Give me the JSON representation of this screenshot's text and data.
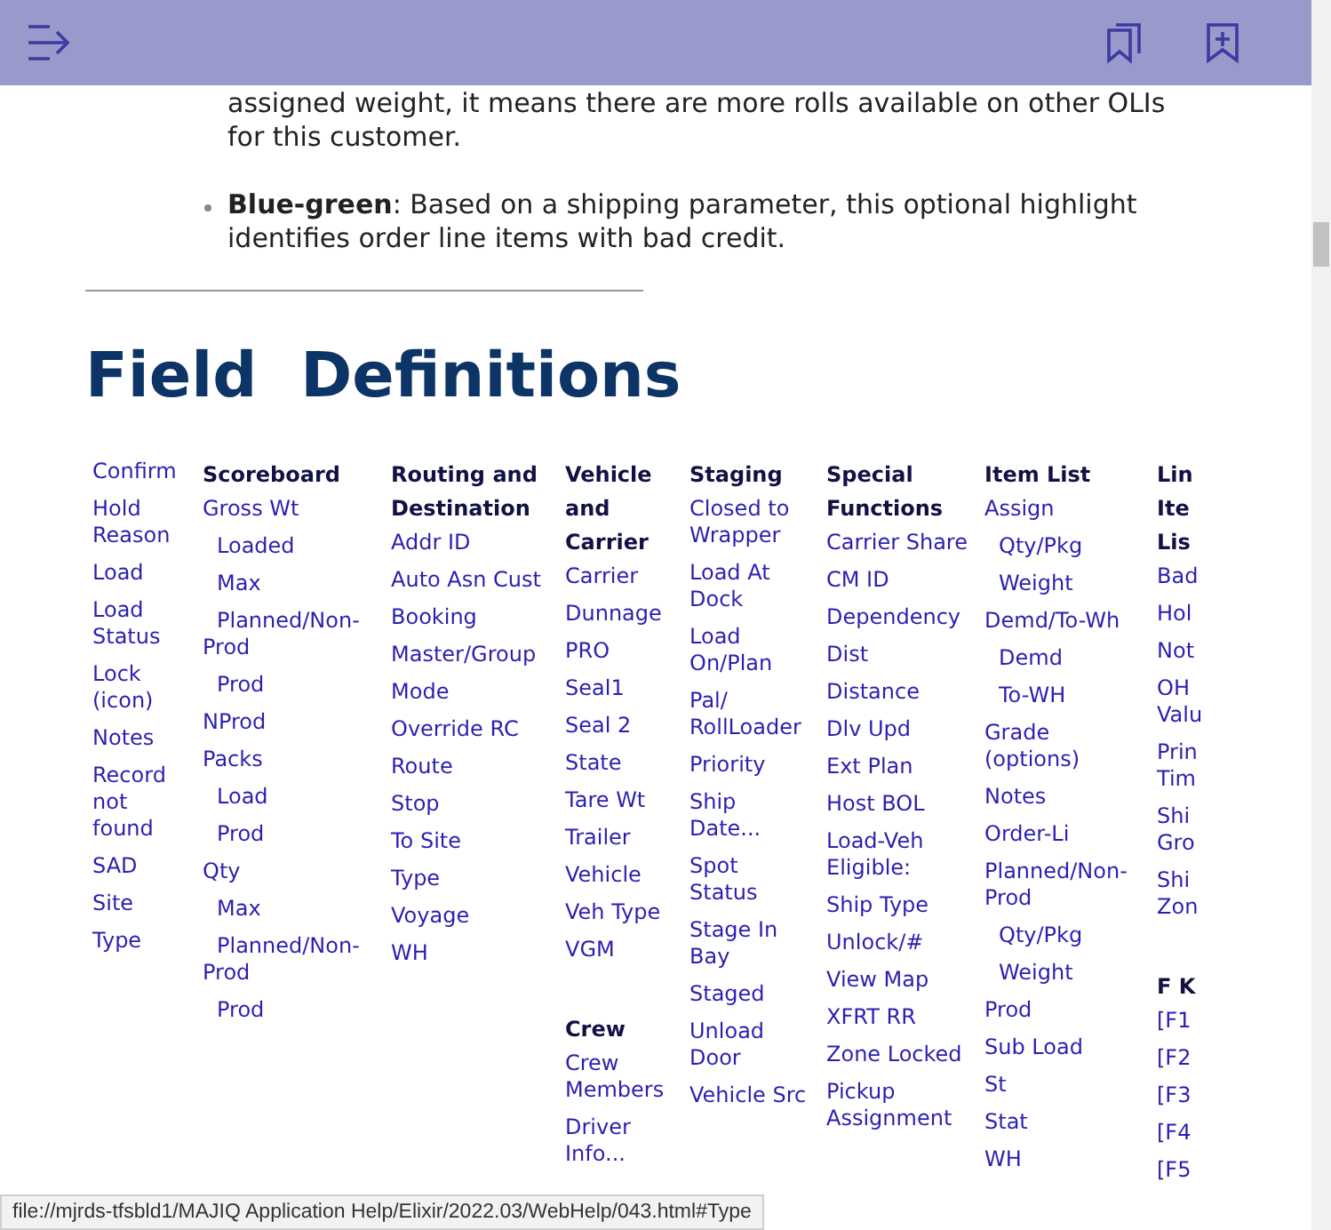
{
  "toolbar": {
    "buttons": [
      {
        "kind": "toc"
      },
      {
        "kind": "bookmarks"
      },
      {
        "kind": "add-bookmark"
      }
    ]
  },
  "bullets": [
    {
      "text": "assigned weight, it means there are more rolls available on other OLIs for this customer.",
      "bullet": false
    },
    {
      "text": "**Blue-green**: Based on a shipping parameter, this optional highlight identifies order line items with bad credit.",
      "bullet": true
    }
  ],
  "title": "Field  Definitions",
  "columns": [
    {
      "sections": [
        {
          "items": [
            {
              "text": "Confirm",
              "indent": false
            },
            {
              "text": "Hold Reason",
              "indent": false
            },
            {
              "text": "Load",
              "indent": false
            },
            {
              "text": "Load Status",
              "indent": false
            },
            {
              "text": "Lock (icon)",
              "indent": false
            },
            {
              "text": "Notes",
              "indent": false
            },
            {
              "text": "Record not found",
              "indent": false
            },
            {
              "text": "SAD",
              "indent": false
            },
            {
              "text": "Site",
              "indent": false
            },
            {
              "text": "Type",
              "indent": false
            }
          ]
        }
      ]
    },
    {
      "sections": [
        {
          "heading": "Scoreboard",
          "items": [
            {
              "text": "Gross Wt",
              "indent": false
            },
            {
              "text": "Loaded",
              "indent": true
            },
            {
              "text": "Max",
              "indent": true
            },
            {
              "text": "Planned/Non-Prod",
              "indent": true
            },
            {
              "text": "Prod",
              "indent": true
            },
            {
              "text": "NProd",
              "indent": false
            },
            {
              "text": "Packs",
              "indent": false
            },
            {
              "text": "Load",
              "indent": true
            },
            {
              "text": "Prod",
              "indent": true
            },
            {
              "text": "Qty",
              "indent": false
            },
            {
              "text": "Max",
              "indent": true
            },
            {
              "text": "Planned/Non-Prod",
              "indent": true
            },
            {
              "text": "Prod",
              "indent": true
            }
          ]
        }
      ]
    },
    {
      "sections": [
        {
          "heading": "Routing and Destination",
          "items": [
            {
              "text": "Addr ID",
              "indent": false
            },
            {
              "text": "Auto Asn Cust",
              "indent": false
            },
            {
              "text": "Booking",
              "indent": false
            },
            {
              "text": "Master/Group",
              "indent": false
            },
            {
              "text": "Mode",
              "indent": false
            },
            {
              "text": "Override RC",
              "indent": false
            },
            {
              "text": "Route",
              "indent": false
            },
            {
              "text": "Stop",
              "indent": false
            },
            {
              "text": "To Site",
              "indent": false
            },
            {
              "text": "Type",
              "indent": false
            },
            {
              "text": "Voyage",
              "indent": false
            },
            {
              "text": "WH",
              "indent": false
            }
          ]
        }
      ]
    },
    {
      "sections": [
        {
          "heading": "Vehicle and Carrier",
          "items": [
            {
              "text": "Carrier",
              "indent": false
            },
            {
              "text": "Dunnage",
              "indent": false
            },
            {
              "text": "PRO",
              "indent": false
            },
            {
              "text": "Seal1",
              "indent": false
            },
            {
              "text": "Seal 2",
              "indent": false
            },
            {
              "text": "State",
              "indent": false
            },
            {
              "text": "Tare Wt",
              "indent": false
            },
            {
              "text": "Trailer",
              "indent": false
            },
            {
              "text": "Vehicle",
              "indent": false
            },
            {
              "text": "Veh Type",
              "indent": false
            },
            {
              "text": "VGM",
              "indent": false
            }
          ]
        },
        {
          "heading": "Crew",
          "items": [
            {
              "text": "Crew Members",
              "indent": false
            },
            {
              "text": "Driver Info...",
              "indent": false
            }
          ]
        }
      ]
    },
    {
      "sections": [
        {
          "heading": "Staging",
          "items": [
            {
              "text": "Closed to Wrapper",
              "indent": false
            },
            {
              "text": "Load At Dock",
              "indent": false
            },
            {
              "text": "Load On/Plan",
              "indent": false
            },
            {
              "text": "Pal/ RollLoader",
              "indent": false
            },
            {
              "text": "Priority",
              "indent": false
            },
            {
              "text": "Ship Date...",
              "indent": false
            },
            {
              "text": "Spot Status",
              "indent": false
            },
            {
              "text": "Stage In Bay",
              "indent": false
            },
            {
              "text": "Staged",
              "indent": false
            },
            {
              "text": "Unload Door",
              "indent": false
            },
            {
              "text": "Vehicle Src",
              "indent": false
            }
          ]
        }
      ]
    },
    {
      "sections": [
        {
          "heading": "Special Functions",
          "items": [
            {
              "text": "Carrier Share",
              "indent": false
            },
            {
              "text": "CM ID",
              "indent": false
            },
            {
              "text": "Dependency",
              "indent": false
            },
            {
              "text": "Dist",
              "indent": false
            },
            {
              "text": "Distance",
              "indent": false
            },
            {
              "text": "Dlv Upd",
              "indent": false
            },
            {
              "text": "Ext Plan",
              "indent": false
            },
            {
              "text": "Host BOL",
              "indent": false
            },
            {
              "text": "Load-Veh Eligible:",
              "indent": false
            },
            {
              "text": "Ship Type",
              "indent": false
            },
            {
              "text": "Unlock/#",
              "indent": false
            },
            {
              "text": "View Map",
              "indent": false
            },
            {
              "text": "XFRT RR",
              "indent": false
            },
            {
              "text": "Zone Locked",
              "indent": false
            },
            {
              "text": "Pickup Assignment",
              "indent": false
            }
          ]
        }
      ]
    },
    {
      "sections": [
        {
          "heading": "Item List",
          "items": [
            {
              "text": "Assign",
              "indent": false
            },
            {
              "text": "Qty/Pkg",
              "indent": true
            },
            {
              "text": "Weight",
              "indent": true
            },
            {
              "text": "Demd/To-Wh",
              "indent": false
            },
            {
              "text": "Demd",
              "indent": true
            },
            {
              "text": "To-WH",
              "indent": true
            },
            {
              "text": "Grade (options)",
              "indent": false
            },
            {
              "text": "Notes",
              "indent": false
            },
            {
              "text": "Order-Li",
              "indent": false
            },
            {
              "text": "Planned/Non-Prod",
              "indent": false
            },
            {
              "text": "Qty/Pkg",
              "indent": true
            },
            {
              "text": "Weight",
              "indent": true
            },
            {
              "text": "Prod",
              "indent": false
            },
            {
              "text": "Sub Load",
              "indent": false
            },
            {
              "text": "St",
              "indent": false
            },
            {
              "text": "Stat",
              "indent": false
            },
            {
              "text": "WH",
              "indent": false
            }
          ]
        }
      ]
    },
    {
      "sections": [
        {
          "heading": "Lin Ite Lis",
          "items": [
            {
              "text": "Bad",
              "indent": false
            },
            {
              "text": "Hol",
              "indent": false
            },
            {
              "text": "Not",
              "indent": false
            },
            {
              "text": "OH Valu",
              "indent": false
            },
            {
              "text": "Prin Tim",
              "indent": false
            },
            {
              "text": "Shi Gro",
              "indent": false
            },
            {
              "text": "Shi Zon",
              "indent": false
            }
          ]
        },
        {
          "heading": "F K",
          "items": [
            {
              "text": "[F1",
              "indent": false
            },
            {
              "text": "[F2",
              "indent": false
            },
            {
              "text": "[F3",
              "indent": false
            },
            {
              "text": "[F4",
              "indent": false
            },
            {
              "text": "[F5",
              "indent": false
            }
          ]
        }
      ]
    }
  ],
  "status_url": "file://mjrds-tfsbld1/MAJIQ Application Help/Elixir/2022.03/WebHelp/043.html#Type"
}
